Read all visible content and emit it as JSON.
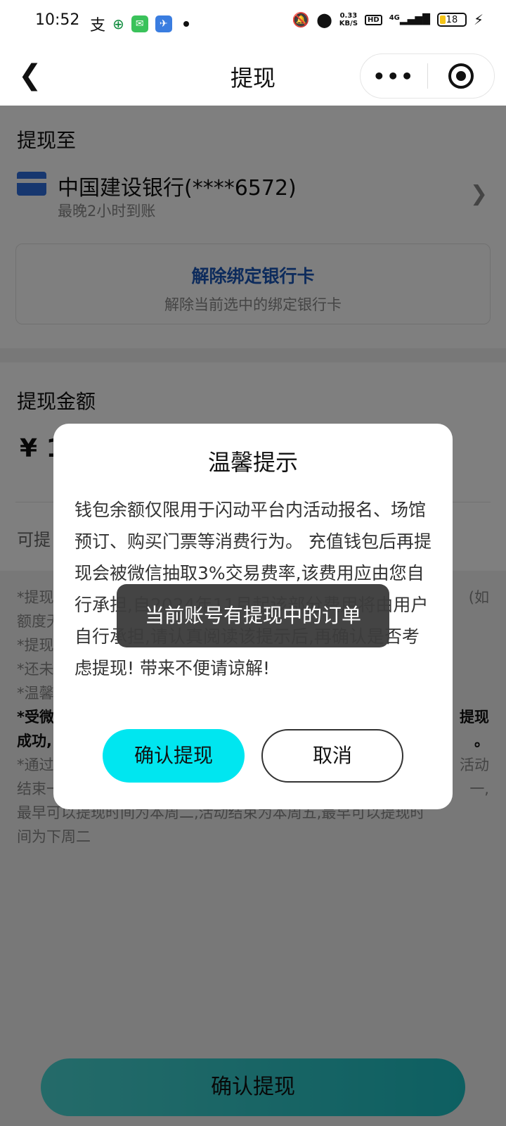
{
  "status_bar": {
    "time": "10:52",
    "speed_value": "0.33",
    "speed_unit": "KB/S",
    "hd": "HD",
    "network": "4G",
    "battery": "18"
  },
  "nav": {
    "title": "提现",
    "more": "•••"
  },
  "withdraw_to": {
    "title": "提现至",
    "bank_name": "中国建设银行(****6572)",
    "eta": "最晚2小时到账",
    "unbind_title": "解除绑定银行卡",
    "unbind_desc": "解除当前选中的绑定银行卡"
  },
  "amount_section": {
    "title": "提现金额",
    "amount_prefix": "¥ 1",
    "available_label": "可提"
  },
  "notes": {
    "line1": "*提现",
    "line1_tail": "(如",
    "line2": "额度无",
    "line3": "*提现",
    "line4": "*还未",
    "line5": "*温馨",
    "line6_b": "*受微",
    "line6_tail": "提现",
    "line7_b": "成功,",
    "line7_tail": "。",
    "line8": "*通过",
    "line8_tail": "活动",
    "line9": "结束一",
    "line9_tail": "一,",
    "line10": "最早可以提现时间为本周二,活动结束为本周五,最早可以提现时",
    "line11": "间为下周二"
  },
  "bottom_button": "确认提现",
  "dialog": {
    "title": "温馨提示",
    "body": "钱包余额仅限用于闪动平台内活动报名、场馆预订、购买门票等消费行为。 充值钱包后再提现会被微信抽取3%交易费率,该费用应由您自行承担,自2024年11月起该部分费用将由用户自行承担,请认真阅读该提示后,再确认是否考虑提现! 带来不便请谅解!",
    "confirm": "确认提现",
    "cancel": "取消"
  },
  "toast": "当前账号有提现中的订单"
}
